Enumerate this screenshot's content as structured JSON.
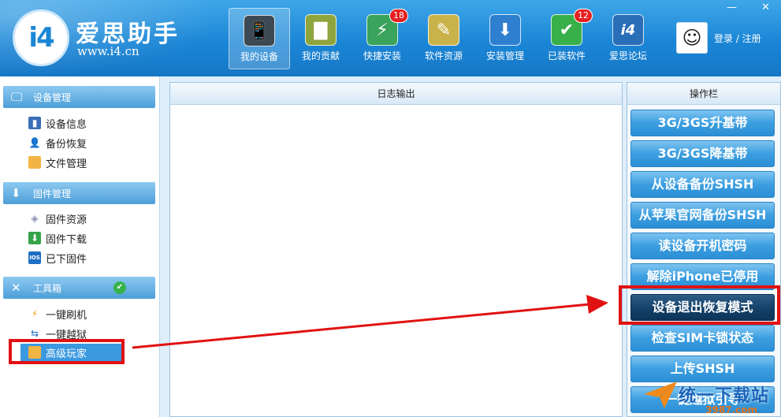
{
  "header": {
    "brand_name": "爱思助手",
    "brand_url": "www.i4.cn",
    "logo_text": "i4",
    "nav": [
      {
        "label": "我的设备",
        "icon": "phone-icon",
        "badge": ""
      },
      {
        "label": "我的贡献",
        "icon": "bar-chart-icon",
        "badge": ""
      },
      {
        "label": "快捷安装",
        "icon": "usb-icon",
        "badge": "18"
      },
      {
        "label": "软件资源",
        "icon": "app-store-icon",
        "badge": ""
      },
      {
        "label": "安装管理",
        "icon": "download-icon",
        "badge": ""
      },
      {
        "label": "已装软件",
        "icon": "check-icon",
        "badge": "12"
      },
      {
        "label": "爱思论坛",
        "icon": "forum-icon",
        "badge": ""
      }
    ],
    "login_text": "登录 / 注册",
    "window_controls": {
      "minimize": "—",
      "close": "✕"
    }
  },
  "sidebar": {
    "sections": [
      {
        "title": "设备管理",
        "items": [
          "设备信息",
          "备份恢复",
          "文件管理"
        ]
      },
      {
        "title": "固件管理",
        "items": [
          "固件资源",
          "固件下载",
          "已下固件"
        ]
      },
      {
        "title": "工具箱",
        "items": [
          "一键刷机",
          "一键越狱",
          "高级玩家"
        ]
      }
    ]
  },
  "log": {
    "title": "日志输出"
  },
  "ops": {
    "title": "操作栏",
    "buttons": [
      "3G/3GS升基带",
      "3G/3GS降基带",
      "从设备备份SHSH",
      "从苹果官网备份SHSH",
      "读设备开机密码",
      "解除iPhone已停用",
      "设备退出恢复模式",
      "检查SIM卡锁状态",
      "上传SHSH",
      "一键越狱引导"
    ]
  },
  "watermark": {
    "text": "统一下载站",
    "sub": "3987.com"
  },
  "colors": {
    "accent": "#1b86d6",
    "highlight": "#e01212",
    "active_button": "#123f66"
  }
}
